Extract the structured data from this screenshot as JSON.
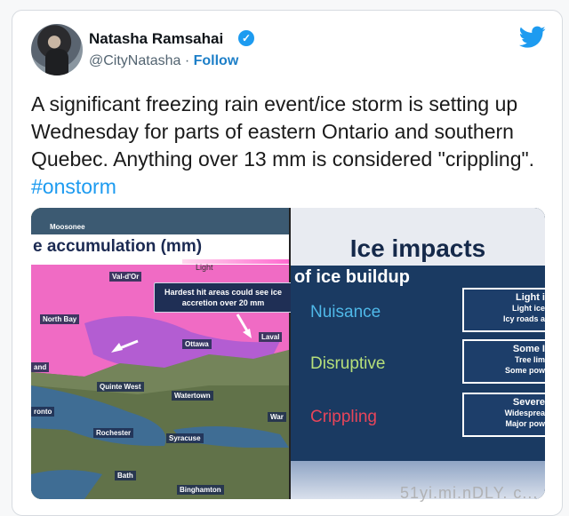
{
  "tweet": {
    "author_name": "Natasha Ramsahai",
    "handle": "@CityNatasha",
    "separator": " · ",
    "follow_label": "Follow",
    "text_before_hashtag": "A significant freezing rain event/ice storm is setting up Wednesday for parts of eastern Ontario and southern Quebec. Anything over 13 mm is considered \"crippling\". ",
    "hashtag": "#onstorm",
    "verified_icon": "verified-badge-icon",
    "bird_icon": "twitter-bird-icon",
    "accent_color": "#1d9bf0"
  },
  "map": {
    "title": "e accumulation (mm)",
    "legend_label": "Light",
    "callout": "Hardest hit areas could see ice accretion over 20 mm",
    "places": [
      "Moosonee",
      "Val-d'Or",
      "North Bay",
      "Ottawa",
      "Laval",
      "Quinte West",
      "Watertown",
      "Rochester",
      "Syracuse",
      "Bath",
      "Binghamton",
      "ronto",
      "and",
      "War"
    ]
  },
  "panel": {
    "title": "Ice impacts",
    "subtitle": "of ice buildup",
    "levels": [
      {
        "label": "Nuisance",
        "color": "#4fb8e8",
        "box_title": "Light i",
        "box_lines": [
          "Light ice",
          "Icy roads a"
        ]
      },
      {
        "label": "Disruptive",
        "color": "#b6df7a",
        "box_title": "Some I",
        "box_lines": [
          "Tree lim",
          "Some pow"
        ]
      },
      {
        "label": "Crippling",
        "color": "#e8455a",
        "box_title": "Severe",
        "box_lines": [
          "Widesprea",
          "Major pow"
        ]
      }
    ]
  },
  "watermark": "51yi.mi.nDLY. c..."
}
